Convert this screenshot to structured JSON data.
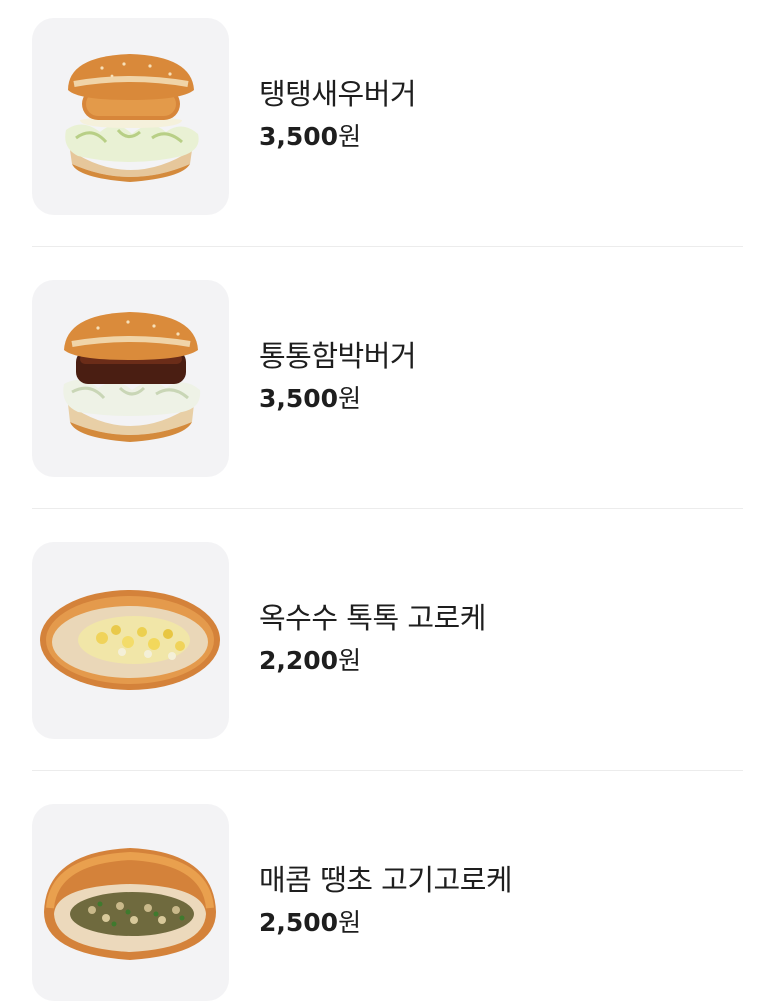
{
  "menu": {
    "items": [
      {
        "name": "탱탱새우버거",
        "price": "3,500",
        "currency": "원",
        "image": "shrimp-burger"
      },
      {
        "name": "통통함박버거",
        "price": "3,500",
        "currency": "원",
        "image": "hamburg-steak-burger"
      },
      {
        "name": "옥수수 톡톡 고로케",
        "price": "2,200",
        "currency": "원",
        "image": "corn-croquette"
      },
      {
        "name": "매콤 땡초 고기고로케",
        "price": "2,500",
        "currency": "원",
        "image": "spicy-pepper-meat-croquette"
      }
    ]
  },
  "colors": {
    "thumb_bg": "#f3f3f5",
    "divider": "#ececec",
    "text": "#1e1e1e",
    "bun": "#d98a3a"
  }
}
